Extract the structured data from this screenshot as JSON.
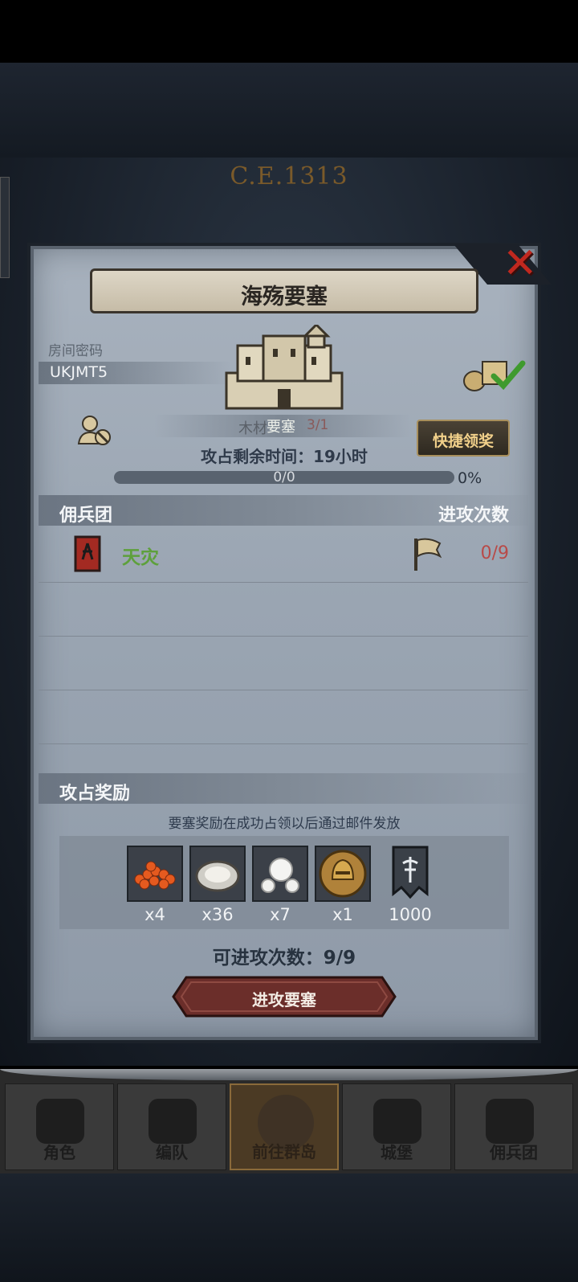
{
  "background": {
    "year": "C.E.1313"
  },
  "dialog": {
    "title": "海殇要塞",
    "room_label": "房间密码",
    "room_code": "UKJMT5",
    "resource_label": "木材",
    "fort_label": "要塞",
    "resource_value": "3/1",
    "quick_claim": "快捷领奖",
    "time_remaining": "攻占剩余时间：19小时",
    "progress_text": "0/0",
    "progress_pct": "0%",
    "progress_value": 0,
    "mercenary_header": "佣兵团",
    "attack_header": "进攻次数",
    "guilds": [
      {
        "name": "天灾",
        "attacks": "0/9"
      }
    ],
    "rewards_header": "攻占奖励",
    "rewards_note": "要塞奖励在成功占领以后通过邮件发放",
    "rewards": [
      {
        "icon": "roe-icon",
        "count": "x4"
      },
      {
        "icon": "oyster-icon",
        "count": "x36"
      },
      {
        "icon": "pearl-icon",
        "count": "x7"
      },
      {
        "icon": "helmet-medal-icon",
        "count": "x1"
      },
      {
        "icon": "guild-banner-icon",
        "count": "1000"
      }
    ],
    "attempts": "可进攻次数：9/9",
    "attack_button": "进攻要塞"
  },
  "nav": [
    {
      "label": "角色",
      "icon": "knight-icon"
    },
    {
      "label": "编队",
      "icon": "helmet-icon"
    },
    {
      "label": "前往群岛",
      "icon": "compass-icon",
      "active": true
    },
    {
      "label": "城堡",
      "icon": "castle-icon"
    },
    {
      "label": "佣兵团",
      "icon": "mercenary-icon"
    }
  ],
  "colors": {
    "guild_name": "#5ea03c",
    "attack_count": "#b84a48",
    "close": "#c0281f"
  }
}
